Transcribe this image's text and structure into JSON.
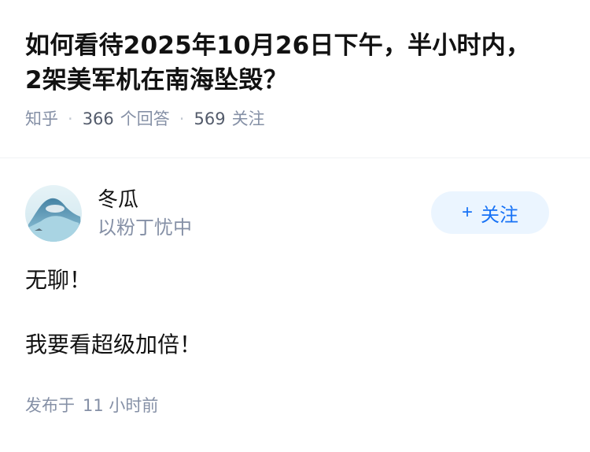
{
  "question": {
    "title": "如何看待2025年10月26日下午，半小时内，2架美军机在南海坠毁？",
    "source": "知乎",
    "answers_count": "366",
    "answers_label": "个回答",
    "followers_count": "569",
    "followers_label": "关注"
  },
  "answer": {
    "author_name": "冬瓜",
    "author_bio": "以粉丁忧中",
    "follow_label": "关注",
    "follow_icon": "plus-icon",
    "paragraphs": [
      "无聊！",
      "我要看超级加倍！"
    ],
    "posted_prefix": "发布于",
    "posted_time": "11 小时前"
  },
  "colors": {
    "accent": "#1772f6",
    "follow_bg": "#ebf5ff",
    "meta_gray": "#8590a6"
  }
}
